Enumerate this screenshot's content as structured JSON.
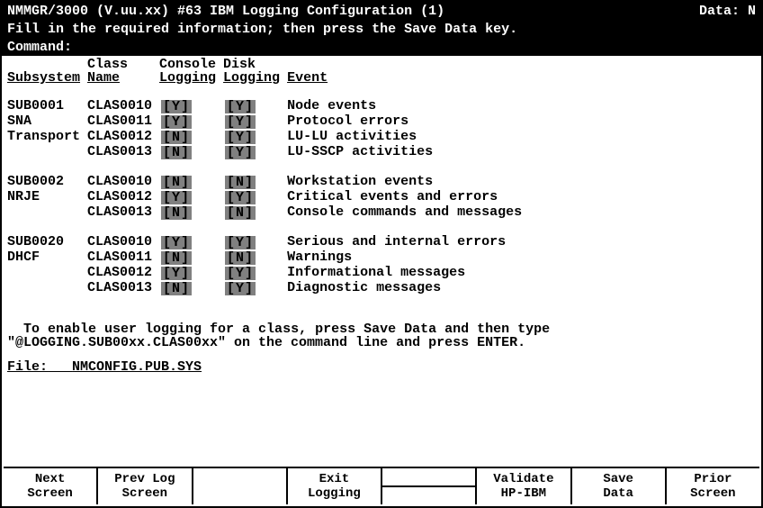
{
  "header": {
    "left": "NMMGR/3000 (V.uu.xx) #63  IBM Logging Configuration (1)",
    "right_label": "Data:",
    "right_value": "N"
  },
  "instruction": "Fill in the required information; then press the Save Data key.",
  "command_label": "Command:",
  "columns": {
    "subsystem": "Subsystem",
    "class_top": "Class",
    "class_bot": "Name",
    "console_top": "Console",
    "console_bot": "Logging",
    "disk_top": "Disk",
    "disk_bot": "Logging",
    "event": "Event"
  },
  "groups": [
    {
      "rows": [
        {
          "subsystem": "SUB0001",
          "class": "CLAS0010",
          "console": "[Y]",
          "disk": "[Y]",
          "event": "Node events"
        },
        {
          "subsystem": "SNA",
          "class": "CLAS0011",
          "console": "[Y]",
          "disk": "[Y]",
          "event": "Protocol errors"
        },
        {
          "subsystem": "Transport",
          "class": "CLAS0012",
          "console": "[N]",
          "disk": "[Y]",
          "event": "LU-LU activities"
        },
        {
          "subsystem": "",
          "class": "CLAS0013",
          "console": "[N]",
          "disk": "[Y]",
          "event": "LU-SSCP activities"
        }
      ]
    },
    {
      "rows": [
        {
          "subsystem": "SUB0002",
          "class": "CLAS0010",
          "console": "[N]",
          "disk": "[N]",
          "event": "Workstation events"
        },
        {
          "subsystem": "NRJE",
          "class": "CLAS0012",
          "console": "[Y]",
          "disk": "[Y]",
          "event": "Critical events and errors"
        },
        {
          "subsystem": "",
          "class": "CLAS0013",
          "console": "[N]",
          "disk": "[N]",
          "event": "Console commands and messages"
        }
      ]
    },
    {
      "rows": [
        {
          "subsystem": "SUB0020",
          "class": "CLAS0010",
          "console": "[Y]",
          "disk": "[Y]",
          "event": "Serious and internal errors"
        },
        {
          "subsystem": "DHCF",
          "class": "CLAS0011",
          "console": "[N]",
          "disk": "[N]",
          "event": "Warnings"
        },
        {
          "subsystem": "",
          "class": "CLAS0012",
          "console": "[Y]",
          "disk": "[Y]",
          "event": "Informational messages"
        },
        {
          "subsystem": "",
          "class": "CLAS0013",
          "console": "[N]",
          "disk": "[Y]",
          "event": "Diagnostic messages"
        }
      ]
    }
  ],
  "hint_line1": "To enable user logging for a class, press Save Data and then type",
  "hint_line2": "\"@LOGGING.SUB00xx.CLAS00xx\" on the command line and press ENTER.",
  "file_label": "File:",
  "file_value": "NMCONFIG.PUB.SYS",
  "fkeys": [
    {
      "l1": "Next",
      "l2": "Screen"
    },
    {
      "l1": "Prev Log",
      "l2": "Screen"
    },
    {
      "l1": "",
      "l2": ""
    },
    {
      "l1": "Exit",
      "l2": "Logging"
    },
    {
      "split": true
    },
    {
      "l1": "Validate",
      "l2": "HP-IBM"
    },
    {
      "l1": "Save",
      "l2": "Data"
    },
    {
      "l1": "Prior",
      "l2": "Screen"
    }
  ]
}
